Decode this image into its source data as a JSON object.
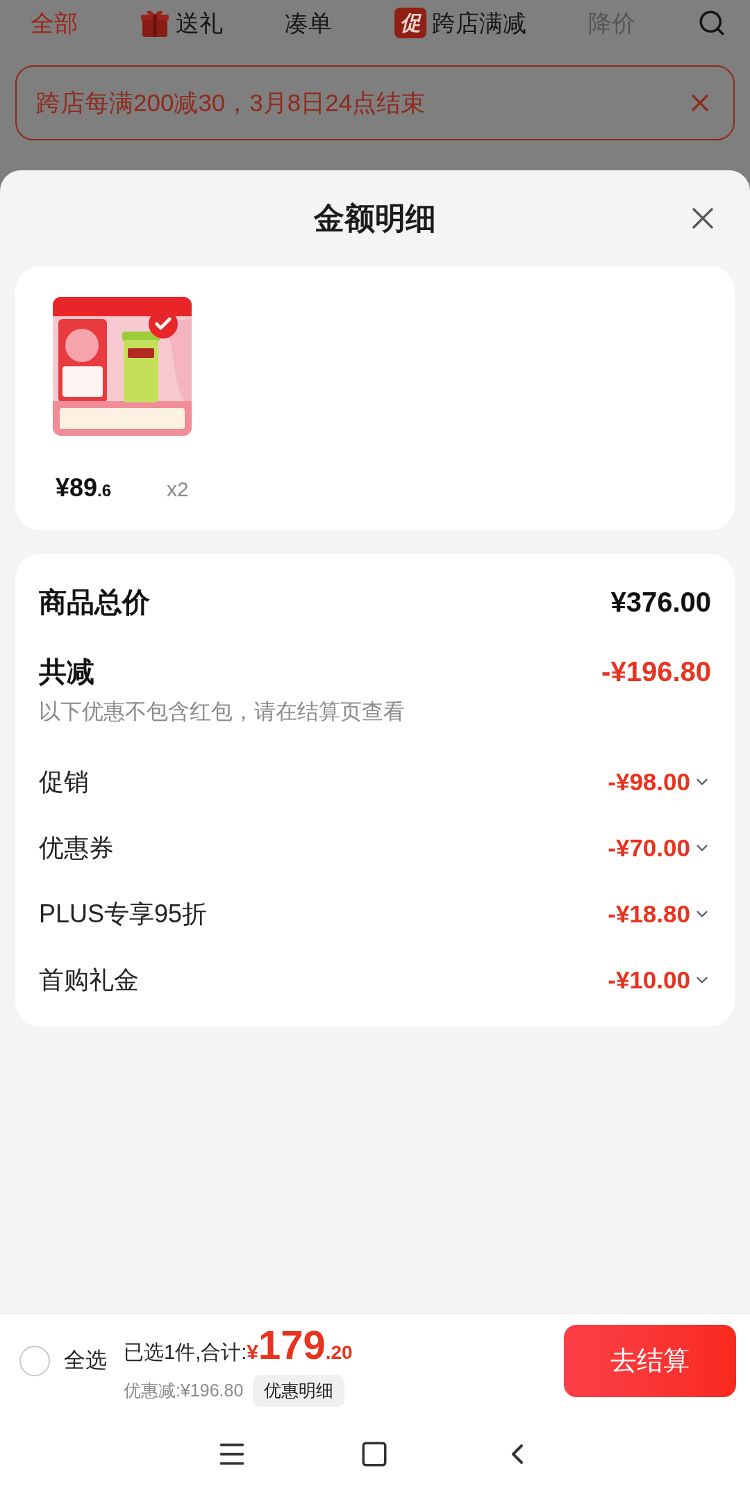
{
  "tabs": [
    {
      "label": "全部",
      "selected": true,
      "disabled": false,
      "kind": "plain"
    },
    {
      "label": "送礼",
      "selected": false,
      "disabled": false,
      "kind": "gift"
    },
    {
      "label": "凑单",
      "selected": false,
      "disabled": false,
      "kind": "plain"
    },
    {
      "label": "跨店满减",
      "selected": false,
      "disabled": false,
      "kind": "badge",
      "badge": "促"
    },
    {
      "label": "降价",
      "selected": false,
      "disabled": true,
      "kind": "plain"
    }
  ],
  "banner": {
    "text": "跨店每满200减30，3月8日24点结束"
  },
  "sheet": {
    "title": "金额明细",
    "product": {
      "kind": "picture",
      "selected": true,
      "price_main": "¥89",
      "price_decimal": ".6",
      "quantity": "x2"
    },
    "total": {
      "label": "商品总价",
      "value": "¥376.00"
    },
    "reduction": {
      "label": "共减",
      "value": "-¥196.80",
      "note": "以下优惠不包含红包，请在结算页查看"
    },
    "discounts": [
      {
        "label": "促销",
        "value": "-¥98.00",
        "expanded": false
      },
      {
        "label": "优惠券",
        "value": "-¥70.00",
        "expanded": false
      },
      {
        "label": "PLUS专享95折",
        "value": "-¥18.80",
        "expanded": false
      },
      {
        "label": "首购礼金",
        "value": "-¥10.00",
        "expanded": false
      }
    ]
  },
  "checkout": {
    "select_all": {
      "label": "全选",
      "checked": false
    },
    "summary": "已选1件,合计:",
    "currency": "¥",
    "total_main": "179",
    "total_decimal": ".20",
    "saved": "优惠减:¥196.80",
    "details_button": "优惠明细",
    "submit": "去结算"
  }
}
